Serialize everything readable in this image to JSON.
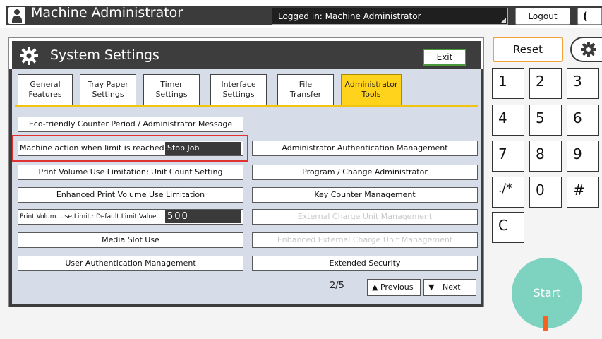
{
  "topbar": {
    "title": "Machine Administrator",
    "login_status": "Logged in: Machine Administrator",
    "logout_label": "Logout",
    "extra_label": "("
  },
  "panel": {
    "title": "System Settings",
    "exit_label": "Exit"
  },
  "tabs": [
    {
      "label": "General\nFeatures",
      "active": false
    },
    {
      "label": "Tray Paper\nSettings",
      "active": false
    },
    {
      "label": "Timer\nSettings",
      "active": false
    },
    {
      "label": "Interface\nSettings",
      "active": false
    },
    {
      "label": "File\nTransfer",
      "active": false
    },
    {
      "label": "Administrator\nTools",
      "active": true
    }
  ],
  "left_options": {
    "eco_message": "Eco-friendly Counter Period / Administrator Message",
    "machine_action_label": "Machine action when limit is reached",
    "machine_action_value": "Stop Job",
    "print_volume_unit": "Print Volume Use Limitation: Unit Count Setting",
    "enhanced_print_volume": "Enhanced Print Volume Use Limitation",
    "default_limit_label": "Print Volum. Use Limit.: Default Limit Value",
    "default_limit_value": "500",
    "media_slot": "Media Slot Use",
    "user_auth": "User Authentication Management"
  },
  "right_options": {
    "admin_auth": "Administrator Authentication Management",
    "program_admin": "Program / Change Administrator",
    "key_counter": "Key Counter Management",
    "external_charge": "External Charge Unit Management",
    "enhanced_external_charge": "Enhanced External Charge Unit Management",
    "extended_security": "Extended Security"
  },
  "pagination": {
    "counter": "2/5",
    "previous_label": "Previous",
    "next_label": "Next"
  },
  "keypad": {
    "reset_label": "Reset",
    "keys": [
      "1",
      "2",
      "3",
      "4",
      "5",
      "6",
      "7",
      "8",
      "9",
      "./*",
      "0",
      "#",
      "C"
    ],
    "start_label": "Start"
  },
  "colors": {
    "active_tab": "#ffd21c",
    "exit_border": "#4a9a3c",
    "reset_border": "#f2a33c",
    "highlight": "#e03232",
    "start": "#7dd3c0"
  }
}
